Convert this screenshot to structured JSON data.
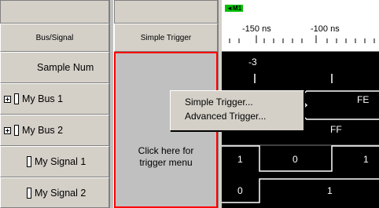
{
  "headers": {
    "bus_signal": "Bus/Signal",
    "trigger": "Simple Trigger"
  },
  "ruler": {
    "marker_label": "M1",
    "tick_labels": [
      "-150 ns",
      "-100 ns"
    ]
  },
  "signals": [
    {
      "name": "Sample Num",
      "type": "number",
      "wave_labels": [
        "-3"
      ]
    },
    {
      "name": "My Bus 1",
      "type": "bus",
      "wave_labels": [
        "FE"
      ]
    },
    {
      "name": "My Bus 2",
      "type": "bus",
      "wave_labels": [
        "FF"
      ]
    },
    {
      "name": "My Signal 1",
      "type": "signal",
      "wave_labels": [
        "1",
        "0",
        "1"
      ]
    },
    {
      "name": "My Signal 2",
      "type": "signal",
      "wave_labels": [
        "0",
        "1"
      ]
    }
  ],
  "trigger_hint": {
    "line1": "Click here for",
    "line2": "trigger menu"
  },
  "context_menu": {
    "items": [
      "Simple Trigger...",
      "Advanced Trigger..."
    ]
  },
  "colors": {
    "trigger_border": "#ff0000",
    "marker": "#00c000",
    "waveform_bg": "#000000",
    "waveform_fg": "#ffffff"
  }
}
